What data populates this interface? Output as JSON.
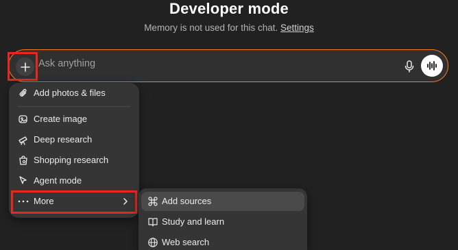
{
  "header": {
    "title": "Developer mode",
    "subtitle_text": "Memory is not used for this chat.",
    "settings_link": "Settings"
  },
  "composer": {
    "placeholder": "Ask anything",
    "plus_icon": "plus-icon",
    "mic_icon": "microphone-icon",
    "voice_icon": "voice-waveform-icon",
    "accent_color": "#ff7a1a"
  },
  "menu": {
    "items": [
      {
        "label": "Add photos & files",
        "icon": "paperclip-icon"
      },
      {
        "label": "Create image",
        "icon": "image-create-icon"
      },
      {
        "label": "Deep research",
        "icon": "telescope-icon"
      },
      {
        "label": "Shopping research",
        "icon": "shopping-bag-icon"
      },
      {
        "label": "Agent mode",
        "icon": "cursor-icon"
      },
      {
        "label": "More",
        "icon": "ellipsis-icon"
      }
    ]
  },
  "submenu": {
    "items": [
      {
        "label": "Add sources",
        "icon": "command-icon"
      },
      {
        "label": "Study and learn",
        "icon": "book-icon"
      },
      {
        "label": "Web search",
        "icon": "globe-icon"
      }
    ]
  },
  "highlight_color": "#e8281e"
}
